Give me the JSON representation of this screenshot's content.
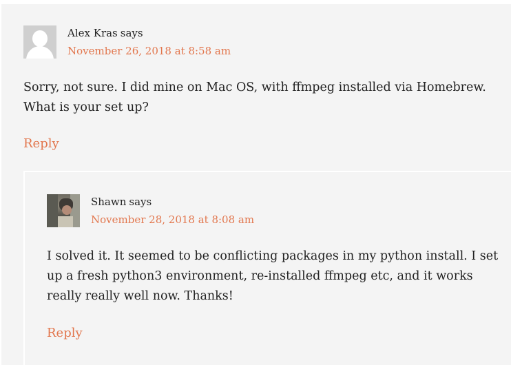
{
  "comments": [
    {
      "author": "Alex Kras",
      "says": "says",
      "date": "November 26, 2018 at 8:58 am",
      "avatar_icon": "default-user-avatar-icon",
      "text_lines": [
        "Sorry, not sure. I did mine on Mac OS, with ffmpeg installed via Homebrew.",
        "What is your set up?"
      ],
      "reply_label": "Reply"
    },
    {
      "author": "Shawn",
      "says": "says",
      "date": "November 28, 2018 at 8:08 am",
      "avatar_icon": "photo-avatar",
      "text_lines": [
        "I solved it. It seemed to be conflicting packages in my python install. I set",
        "up a fresh python3 environment, re-installed ffmpeg etc, and it works",
        "really really well now. Thanks!"
      ],
      "reply_label": "Reply"
    }
  ],
  "colors": {
    "background": "#f4f4f4",
    "link": "#e2764d",
    "text": "#222222"
  }
}
